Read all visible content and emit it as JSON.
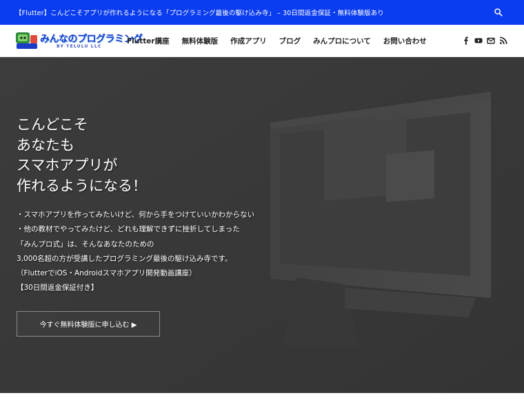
{
  "topbar": {
    "announcement": "【Flutter】こんどこそアプリが作れるようになる「プログラミング最後の駆け込み寺」 – 30日間返金保証・無料体験版あり",
    "background": "#0a3cf0",
    "search_icon": "search-icon"
  },
  "header": {
    "logo": {
      "title": "みんなのプログラミング",
      "subtitle": "BY TELULU LLC"
    },
    "nav": [
      {
        "label": "Flutter講座"
      },
      {
        "label": "無料体験版"
      },
      {
        "label": "作成アプリ"
      },
      {
        "label": "ブログ"
      },
      {
        "label": "みんプロについて"
      },
      {
        "label": "お問い合わせ"
      }
    ],
    "social_icons": [
      "facebook-icon",
      "youtube-icon",
      "mail-icon",
      "rss-icon"
    ]
  },
  "hero": {
    "title_lines": [
      "こんどこそ",
      "あなたも",
      "スマホアプリが",
      "作れるようになる！"
    ],
    "description_lines": [
      "・スマホアプリを作ってみたいけど、何から手をつけていいかわからない",
      "・他の教材でやってみたけど、どれも理解できずに挫折してしまった",
      "「みんプロ式」は、そんなあなたのための",
      "3,000名超の方が受講したプログラミング最後の駆け込み寺です。",
      "（FlutterでiOS・Androidスマホアプリ開発動画講座）",
      "【30日間返金保証付き】"
    ],
    "cta_label": "今すぐ無料体験版に申し込む ▶",
    "background": "#3a3a3a"
  }
}
